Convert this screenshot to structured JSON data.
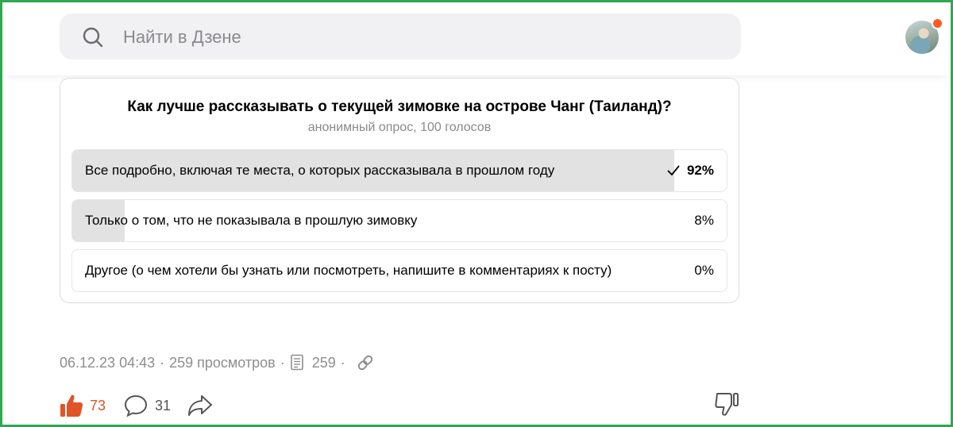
{
  "search": {
    "placeholder": "Найти в Дзене",
    "icon": "search-icon"
  },
  "avatar": {
    "notification_color": "#ff5a1f"
  },
  "poll": {
    "question": "Как лучше рассказывать о текущей зимовке на острове Чанг (Таиланд)?",
    "subtitle": "анонимный опрос, 100 голосов",
    "options": [
      {
        "label": "Все подробно, включая те места, о которых рассказывала в прошлом году",
        "percent_text": "92%",
        "percent": 92,
        "selected": true
      },
      {
        "label": "Только о том, что не показывала в прошлую зимовку",
        "percent_text": "8%",
        "percent": 8,
        "selected": false
      },
      {
        "label": "Другое (о чем хотели бы узнать или посмотреть, напишите в комментариях к посту)",
        "percent_text": "0%",
        "percent": 0,
        "selected": false
      }
    ]
  },
  "meta": {
    "date": "06.12.23 04:43",
    "sep": "·",
    "views": "259 просмотров",
    "reads": "259"
  },
  "actions": {
    "likes": "73",
    "comments": "31",
    "like_color": "#e0542a"
  },
  "colors": {
    "frame": "#2fa84f",
    "bar_fill": "#e2e2e2"
  }
}
